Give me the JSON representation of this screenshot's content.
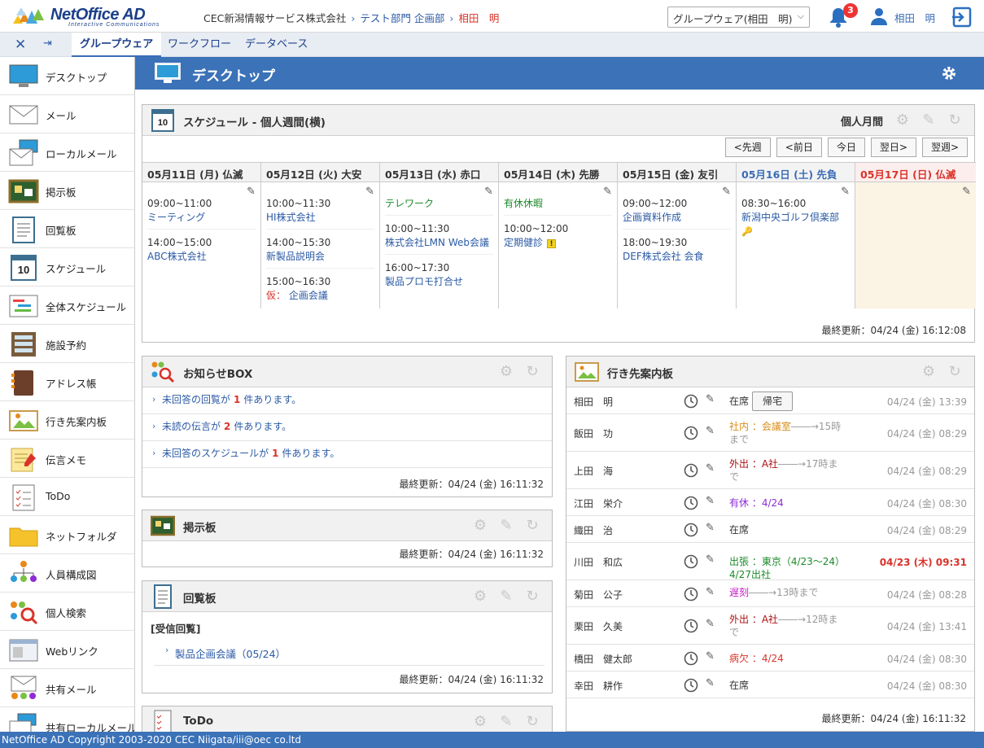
{
  "brand": {
    "name": "NetOffice AD",
    "tagline": "Interactive Communications"
  },
  "breadcrumb": {
    "company": "CEC新潟情報サービス株式会社",
    "dept": "テスト部門 企画部",
    "user": "相田　明"
  },
  "selector": {
    "value": "グループウェア(相田　明)"
  },
  "notifications": {
    "count": "3"
  },
  "user": {
    "name": "相田　明"
  },
  "tabs": [
    "グループウェア",
    "ワークフロー",
    "データベース"
  ],
  "sidebar": {
    "items": [
      "デスクトップ",
      "メール",
      "ローカルメール",
      "掲示板",
      "回覧板",
      "スケジュール",
      "全体スケジュール",
      "施設予約",
      "アドレス帳",
      "行き先案内板",
      "伝言メモ",
      "ToDo",
      "ネットフォルダ",
      "人員構成図",
      "個人検索",
      "Webリンク",
      "共有メール",
      "共有ローカルメール"
    ]
  },
  "page": {
    "title": "デスクトップ"
  },
  "schedule": {
    "title": "スケジュール - 個人週間(横)",
    "view_label": "個人月間",
    "nav": [
      "<先週",
      "<前日",
      "今日",
      "翌日>",
      "翌週>"
    ],
    "days": [
      {
        "label": "05月11日 (月) 仏滅",
        "events": [
          {
            "time": "09:00~11:00",
            "title": "ミーティング"
          },
          {
            "time": "14:00~15:00",
            "title": "ABC株式会社"
          }
        ]
      },
      {
        "label": "05月12日 (火) 大安",
        "events": [
          {
            "time": "10:00~11:30",
            "title": "HI株式会社"
          },
          {
            "time": "14:00~15:30",
            "title": "新製品説明会"
          },
          {
            "time": "15:00~16:30",
            "prefix": "仮：",
            "title": "企画会議"
          }
        ]
      },
      {
        "label": "05月13日 (水) 赤口",
        "events": [
          {
            "time": "",
            "title": "テレワーク",
            "green": true
          },
          {
            "time": "10:00~11:30",
            "title": "株式会社LMN Web会議"
          },
          {
            "time": "16:00~17:30",
            "title": "製品プロモ打合せ"
          }
        ]
      },
      {
        "label": "05月14日 (木) 先勝",
        "events": [
          {
            "time": "",
            "title": "有休休暇",
            "green": true
          },
          {
            "time": "10:00~12:00",
            "title": "定期健診",
            "warn": true
          }
        ]
      },
      {
        "label": "05月15日 (金) 友引",
        "events": [
          {
            "time": "09:00~12:00",
            "title": "企画資料作成"
          },
          {
            "time": "18:00~19:30",
            "title": "DEF株式会社 会食"
          }
        ]
      },
      {
        "label": "05月16日 (土) 先負",
        "events": [
          {
            "time": "08:30~16:00",
            "title": "新潟中央ゴルフ倶楽部",
            "key": true
          }
        ]
      },
      {
        "label": "05月17日 (日) 仏滅",
        "events": []
      }
    ],
    "updated": "最終更新：04/24 (金) 16:12:08"
  },
  "notice": {
    "title": "お知らせBOX",
    "items": [
      {
        "pre": "未回答の回覧が",
        "num": "1",
        "post": "件あります。"
      },
      {
        "pre": "未読の伝言が",
        "num": "2",
        "post": "件あります。"
      },
      {
        "pre": "未回答のスケジュールが",
        "num": "1",
        "post": "件あります。"
      }
    ],
    "updated": "最終更新：04/24 (金) 16:11:32"
  },
  "bbs": {
    "title": "掲示板",
    "updated": "最終更新：04/24 (金) 16:11:32"
  },
  "circular": {
    "title": "回覧板",
    "section": "[受信回覧]",
    "item": "製品企画会議（05/24）",
    "updated": "最終更新：04/24 (金) 16:11:32"
  },
  "todo": {
    "title": "ToDo"
  },
  "board": {
    "title": "行き先案内板",
    "button": "帰宅",
    "rows": [
      {
        "name": "相田　明",
        "status": "在席",
        "cls": "",
        "time": "04/24 (金) 13:39"
      },
      {
        "name": "飯田　功",
        "status": "社内 ：会議室",
        "status2": "――→15時まで",
        "cls": "orange",
        "time": "04/24 (金) 08:29"
      },
      {
        "name": "上田　海",
        "status": "外出 ：A社",
        "status2": "――→17時まで",
        "cls": "darkred",
        "time": "04/24 (金) 08:29"
      },
      {
        "name": "江田　栄介",
        "status": "有休 ：4/24",
        "cls": "purple",
        "time": "04/24 (金) 08:30"
      },
      {
        "name": "織田　治",
        "status": "在席",
        "cls": "",
        "time": "04/24 (金) 08:29"
      },
      {
        "name": "川田　和広",
        "status": "出張 ：東京（4/23～24）4/27出社",
        "cls": "green",
        "time": "04/23 (木) 09:31",
        "red": true
      },
      {
        "name": "菊田　公子",
        "status": "遅刻",
        "status2": "――→13時まで",
        "cls": "magenta",
        "time": "04/24 (金) 08:28"
      },
      {
        "name": "栗田　久美",
        "status": "外出 ：A社",
        "status2": "――→12時まで",
        "cls": "darkred",
        "time": "04/24 (金) 13:41"
      },
      {
        "name": "橋田　健太郎",
        "status": "病欠 ：4/24",
        "cls": "redt",
        "time": "04/24 (金) 08:30"
      },
      {
        "name": "幸田　耕作",
        "status": "在席",
        "cls": "",
        "time": "04/24 (金) 08:30"
      }
    ],
    "updated": "最終更新：04/24 (金) 16:11:32"
  },
  "footer": {
    "copyright": "NetOffice AD Copyright 2003-2020 CEC Niigata/iii@oec co.ltd"
  }
}
